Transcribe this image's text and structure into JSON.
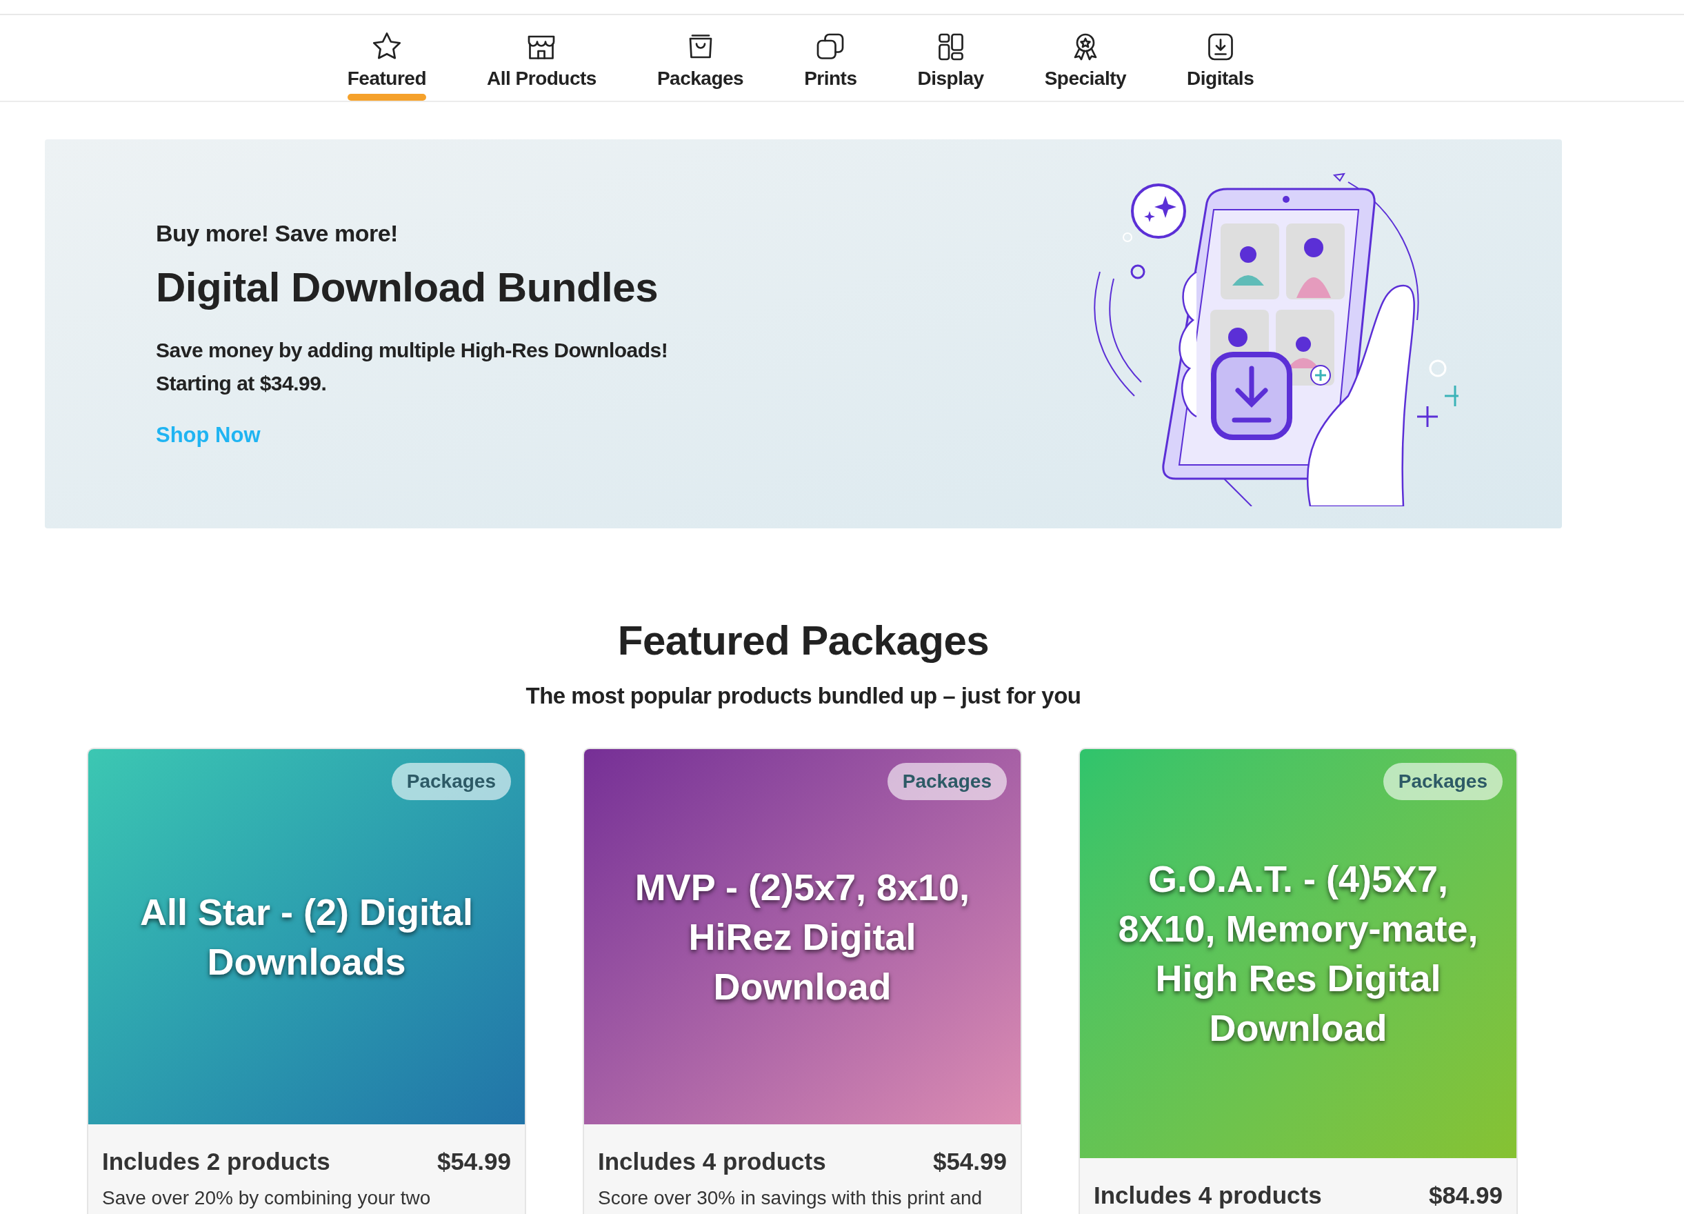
{
  "nav": {
    "tabs": [
      {
        "label": "Featured",
        "selected": true
      },
      {
        "label": "All Products",
        "selected": false
      },
      {
        "label": "Packages",
        "selected": false
      },
      {
        "label": "Prints",
        "selected": false
      },
      {
        "label": "Display",
        "selected": false
      },
      {
        "label": "Specialty",
        "selected": false
      },
      {
        "label": "Digitals",
        "selected": false
      }
    ]
  },
  "banner": {
    "eyebrow": "Buy more! Save more!",
    "title": "Digital Download Bundles",
    "lines": [
      "Save money by adding multiple High-Res Downloads!",
      "Starting at $34.99."
    ],
    "link": "Shop Now"
  },
  "featured": {
    "title": "Featured Packages",
    "subtitle": "The most popular products bundled up – just for you",
    "cards": [
      {
        "badge": "Packages",
        "title": "All Star - (2) Digital Downloads",
        "includes": "Includes 2 products",
        "price": "$54.99",
        "description": "Save over 20% by combining your two"
      },
      {
        "badge": "Packages",
        "title": "MVP - (2)5x7, 8x10, HiRez Digital Download",
        "includes": "Includes 4 products",
        "price": "$54.99",
        "description": "Score over 30% in savings with this print and"
      },
      {
        "badge": "Packages",
        "title": "G.O.A.T. - (4)5X7, 8X10, Memory-mate, High Res Digital Download",
        "includes": "Includes 4 products",
        "price": "$84.99"
      }
    ]
  }
}
